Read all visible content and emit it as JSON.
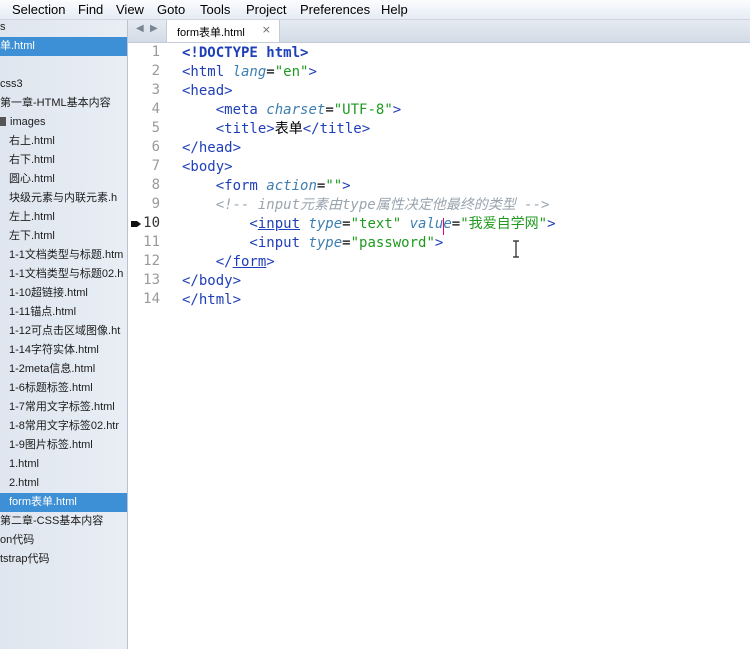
{
  "menu": [
    "Selection",
    "Find",
    "View",
    "Goto",
    "Tools",
    "Project",
    "Preferences",
    "Help"
  ],
  "sidebar": {
    "items": [
      {
        "label": "s",
        "indent": 0
      },
      {
        "label": "单.html",
        "indent": 0,
        "selected": true
      },
      {
        "label": "",
        "indent": 0
      },
      {
        "label": "css3",
        "indent": 0
      },
      {
        "label": "第一章-HTML基本内容",
        "indent": 0
      },
      {
        "label": "images",
        "indent": 9,
        "folder": true
      },
      {
        "label": "右上.html",
        "indent": 9
      },
      {
        "label": "右下.html",
        "indent": 9
      },
      {
        "label": "圆心.html",
        "indent": 9
      },
      {
        "label": "块级元素与内联元素.h",
        "indent": 9
      },
      {
        "label": "左上.html",
        "indent": 9
      },
      {
        "label": "左下.html",
        "indent": 9
      },
      {
        "label": "1-1文档类型与标题.htm",
        "indent": 9
      },
      {
        "label": "1-1文档类型与标题02.h",
        "indent": 9
      },
      {
        "label": "1-10超链接.html",
        "indent": 9
      },
      {
        "label": "1-11锚点.html",
        "indent": 9
      },
      {
        "label": "1-12可点击区域图像.ht",
        "indent": 9
      },
      {
        "label": "1-14字符实体.html",
        "indent": 9
      },
      {
        "label": "1-2meta信息.html",
        "indent": 9
      },
      {
        "label": "1-6标题标签.html",
        "indent": 9
      },
      {
        "label": "1-7常用文字标签.html",
        "indent": 9
      },
      {
        "label": "1-8常用文字标签02.htr",
        "indent": 9
      },
      {
        "label": "1-9图片标签.html",
        "indent": 9
      },
      {
        "label": "1.html",
        "indent": 9
      },
      {
        "label": "2.html",
        "indent": 9
      },
      {
        "label": "form表单.html",
        "indent": 9,
        "selected": true
      },
      {
        "label": "第二章-CSS基本内容",
        "indent": 0
      },
      {
        "label": "on代码",
        "indent": 0
      },
      {
        "label": "tstrap代码",
        "indent": 0
      }
    ]
  },
  "tab": {
    "label": "form表单.html",
    "close": "×"
  },
  "nav": {
    "back": "◀",
    "forward": "▶"
  },
  "editor": {
    "current_line": 10,
    "lines": [
      [
        {
          "t": "<!DOCTYPE html>",
          "c": "dt"
        }
      ],
      [
        {
          "t": "<html ",
          "c": "t"
        },
        {
          "t": "lang",
          "c": "a"
        },
        {
          "t": "=",
          "c": "p"
        },
        {
          "t": "\"en\"",
          "c": "s"
        },
        {
          "t": ">",
          "c": "t"
        }
      ],
      [
        {
          "t": "<head>",
          "c": "t"
        }
      ],
      [
        {
          "t": "    <meta ",
          "c": "t"
        },
        {
          "t": "charset",
          "c": "a"
        },
        {
          "t": "=",
          "c": "p"
        },
        {
          "t": "\"UTF-8\"",
          "c": "s"
        },
        {
          "t": ">",
          "c": "t"
        }
      ],
      [
        {
          "t": "    <title>",
          "c": "t"
        },
        {
          "t": "表单",
          "c": "p"
        },
        {
          "t": "</title>",
          "c": "t"
        }
      ],
      [
        {
          "t": "</head>",
          "c": "t"
        }
      ],
      [
        {
          "t": "<body>",
          "c": "t"
        }
      ],
      [
        {
          "t": "    <form ",
          "c": "t"
        },
        {
          "t": "action",
          "c": "a"
        },
        {
          "t": "=",
          "c": "p"
        },
        {
          "t": "\"\"",
          "c": "s"
        },
        {
          "t": ">",
          "c": "t"
        }
      ],
      [
        {
          "t": "    <!-- input元素由type属性决定他最终的类型 -->",
          "c": "c"
        }
      ],
      [
        {
          "t": "        <",
          "c": "t"
        },
        {
          "t": "input",
          "c": "t ul"
        },
        {
          "t": " ",
          "c": "t"
        },
        {
          "t": "type",
          "c": "a"
        },
        {
          "t": "=",
          "c": "p"
        },
        {
          "t": "\"text\"",
          "c": "s"
        },
        {
          "t": " ",
          "c": "t"
        },
        {
          "t": "value",
          "c": "a"
        },
        {
          "t": "=",
          "c": "p"
        },
        {
          "t": "\"我爱自学网\"",
          "c": "s"
        },
        {
          "t": ">",
          "c": "t"
        }
      ],
      [
        {
          "t": "        <input ",
          "c": "t"
        },
        {
          "t": "type",
          "c": "a"
        },
        {
          "t": "=",
          "c": "p"
        },
        {
          "t": "\"password\"",
          "c": "s"
        },
        {
          "t": ">",
          "c": "t"
        }
      ],
      [
        {
          "t": "    </",
          "c": "t"
        },
        {
          "t": "form",
          "c": "t ul"
        },
        {
          "t": ">",
          "c": "t"
        }
      ],
      [
        {
          "t": "</body>",
          "c": "t"
        }
      ],
      [
        {
          "t": "</html>",
          "c": "t"
        }
      ]
    ]
  }
}
